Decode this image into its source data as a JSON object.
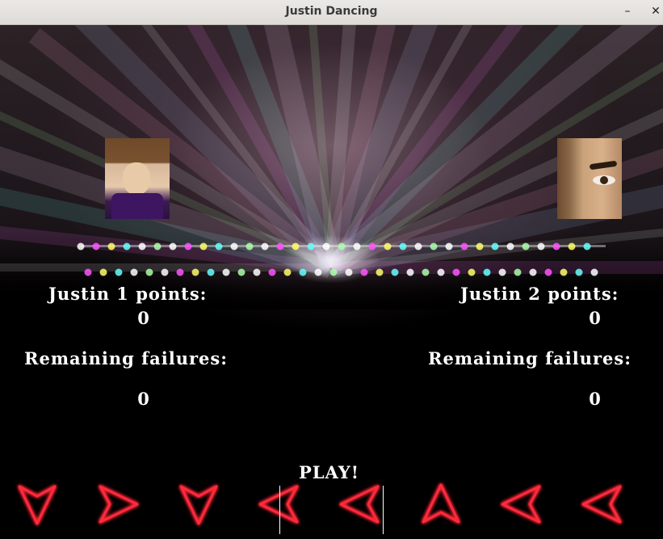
{
  "window": {
    "title": "Justin Dancing",
    "minimize_glyph": "–",
    "close_glyph": "✕"
  },
  "player1": {
    "points_label": "Justin 1 points:",
    "points": "0",
    "failures_label": "Remaining failures:",
    "failures": "0",
    "avatar": "justin-portrait"
  },
  "player2": {
    "points_label": "Justin 2 points:",
    "points": "0",
    "failures_label": "Remaining failures:",
    "failures": "0",
    "avatar": "eye-closeup-portrait"
  },
  "play_label": "PLAY!",
  "arrows": [
    "down",
    "right",
    "down",
    "left",
    "left",
    "up",
    "left",
    "left"
  ],
  "colors": {
    "arrow_glow": "#ff2a3a",
    "text": "#ffffff",
    "background": "#000000"
  }
}
